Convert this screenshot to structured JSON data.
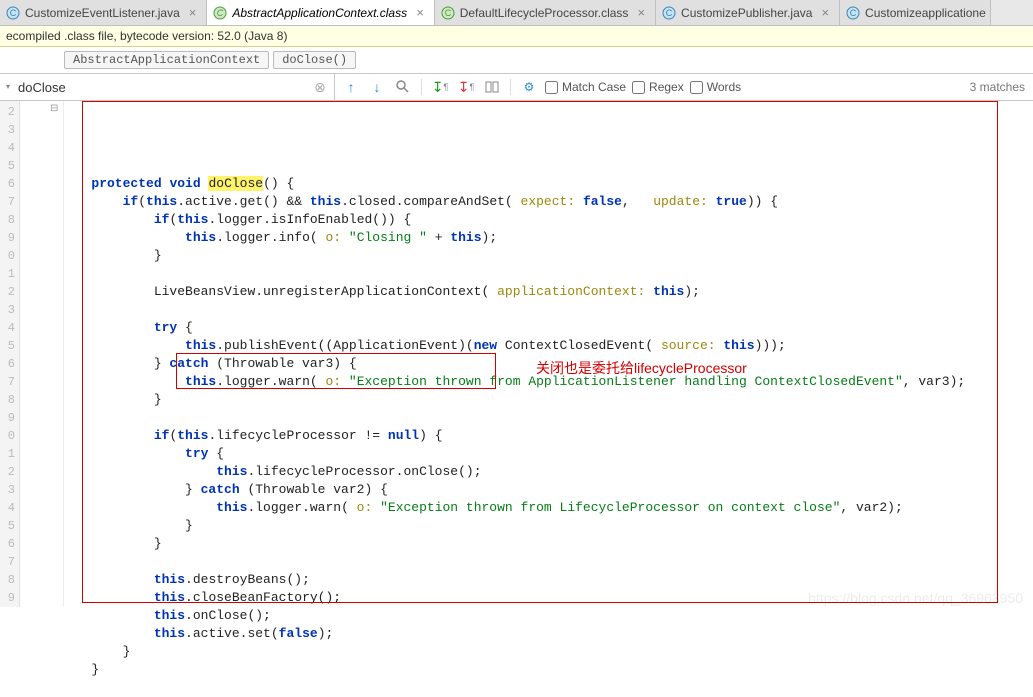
{
  "tabs": [
    {
      "label": "CustomizeEventListener.java",
      "active": false
    },
    {
      "label": "AbstractApplicationContext.class",
      "active": true
    },
    {
      "label": "DefaultLifecycleProcessor.class",
      "active": false
    },
    {
      "label": "CustomizePublisher.java",
      "active": false
    },
    {
      "label": "Customizeapplicatione",
      "active": false,
      "truncated": true
    }
  ],
  "hint_bar": "ecompiled .class file, bytecode version: 52.0 (Java 8)",
  "breadcrumbs": [
    "AbstractApplicationContext",
    "doClose()"
  ],
  "search": {
    "value": "doClose",
    "match_case": "Match Case",
    "regex": "Regex",
    "words": "Words",
    "matches": "3 matches"
  },
  "gutter_lines": [
    "2",
    "3",
    "4",
    "5",
    "6",
    "7",
    "8",
    "9",
    "0",
    "1",
    "2",
    "3",
    "4",
    "5",
    "6",
    "7",
    "8",
    "9",
    "0",
    "1",
    "2",
    "3",
    "4",
    "5",
    "6",
    "7",
    "8",
    "9"
  ],
  "code": {
    "kw_protected": "protected",
    "kw_void": "void",
    "name_doClose": "doClose",
    "kw_if": "if",
    "kw_this": "this",
    "kw_new": "new",
    "kw_try": "try",
    "kw_catch": "catch",
    "kw_null": "null",
    "kw_false": "false",
    "kw_true": "true",
    "p_expect": "expect:",
    "p_update": "update:",
    "p_o": "o:",
    "p_appctx": "applicationContext:",
    "p_source": "source:",
    "str_closing": "\"Closing \"",
    "str_exc_listener": "\"Exception thrown from ApplicationListener handling ContextClosedEvent\"",
    "str_exc_lp": "\"Exception thrown from LifecycleProcessor on context close\"",
    "t_active_get": ".active.get() && ",
    "t_closed_cas": ".closed.compareAndSet( ",
    "t_logger_info_en": ".logger.isInfoEnabled()) {",
    "t_logger_info": ".logger.info( ",
    "t_plus_this": " + ",
    "t_livebeans": "LiveBeansView.unregisterApplicationContext( ",
    "t_publish": ".publishEvent((ApplicationEvent)(",
    "t_ctxclosed": " ContextClosedEvent( ",
    "t_throwable3": " (Throwable var3) {",
    "t_throwable2": " (Throwable var2) {",
    "t_logger_warn": ".logger.warn( ",
    "t_lp_notnull": ".lifecycleProcessor != ",
    "t_lp_onclose": ".lifecycleProcessor.onClose();",
    "t_var3": ", var3);",
    "t_var2": ", var2);",
    "t_destroyBeans": ".destroyBeans();",
    "t_closeBF": ".closeBeanFactory();",
    "t_onClose": ".onClose();",
    "t_active_set": ".active.set(",
    "annotation": "关闭也是委托给lifecycleProcessor"
  },
  "watermark": "https://blog.csdn.net/qq_36963950"
}
